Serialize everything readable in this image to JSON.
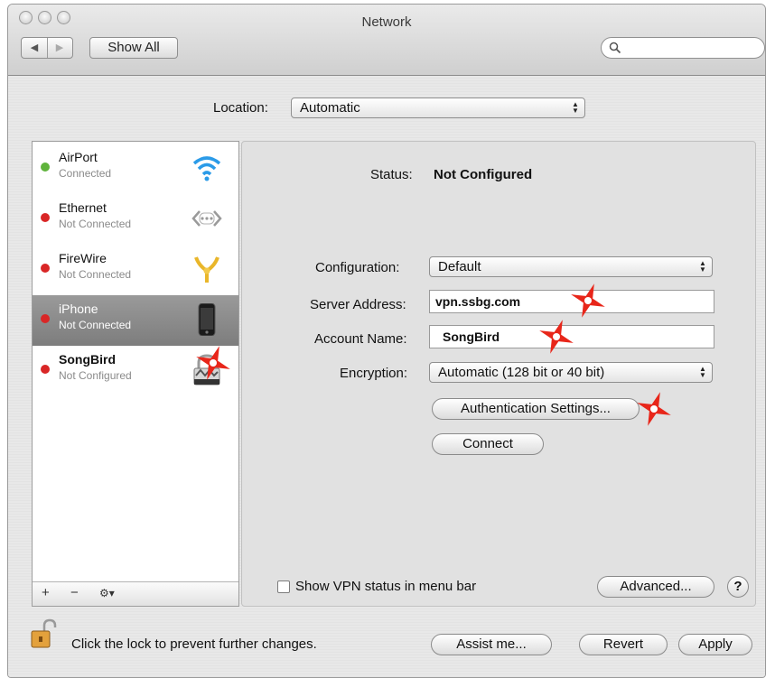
{
  "window": {
    "title": "Network"
  },
  "toolbar": {
    "back_label": "◀",
    "forward_label": "▶",
    "show_all_label": "Show All",
    "search_placeholder": ""
  },
  "location": {
    "label": "Location:",
    "value": "Automatic"
  },
  "sidebar": {
    "items": [
      {
        "name": "AirPort",
        "status": "Connected",
        "dot_color": "#5fb33c",
        "icon": "wifi-icon"
      },
      {
        "name": "Ethernet",
        "status": "Not Connected",
        "dot_color": "#d92626",
        "icon": "ethernet-icon"
      },
      {
        "name": "FireWire",
        "status": "Not Connected",
        "dot_color": "#d92626",
        "icon": "firewire-icon"
      },
      {
        "name": "iPhone",
        "status": "Not Connected",
        "dot_color": "#d92626",
        "icon": "iphone-icon",
        "selected": true
      },
      {
        "name": "SongBird",
        "status": "Not Configured",
        "dot_color": "#d92626",
        "icon": "lock-vpn-icon"
      }
    ],
    "footer": {
      "add": "+",
      "remove": "−",
      "action": "⚙▾"
    }
  },
  "detail": {
    "status_label": "Status:",
    "status_value": "Not Configured",
    "configuration_label": "Configuration:",
    "configuration_value": "Default",
    "server_label": "Server Address:",
    "server_value": "vpn.ssbg.com",
    "account_label": "Account Name:",
    "account_value": "SongBird",
    "encryption_label": "Encryption:",
    "encryption_value": "Automatic (128 bit or 40 bit)",
    "auth_button": "Authentication Settings...",
    "connect_button": "Connect",
    "show_vpn_label": "Show VPN status in menu bar",
    "advanced_button": "Advanced...",
    "help_button": "?"
  },
  "bottom": {
    "lock_text": "Click the lock to prevent further changes.",
    "assist_button": "Assist me...",
    "revert_button": "Revert",
    "apply_button": "Apply"
  },
  "colors": {
    "annotation_star": "#e8261a",
    "selected_row": "#8a8a8a"
  }
}
